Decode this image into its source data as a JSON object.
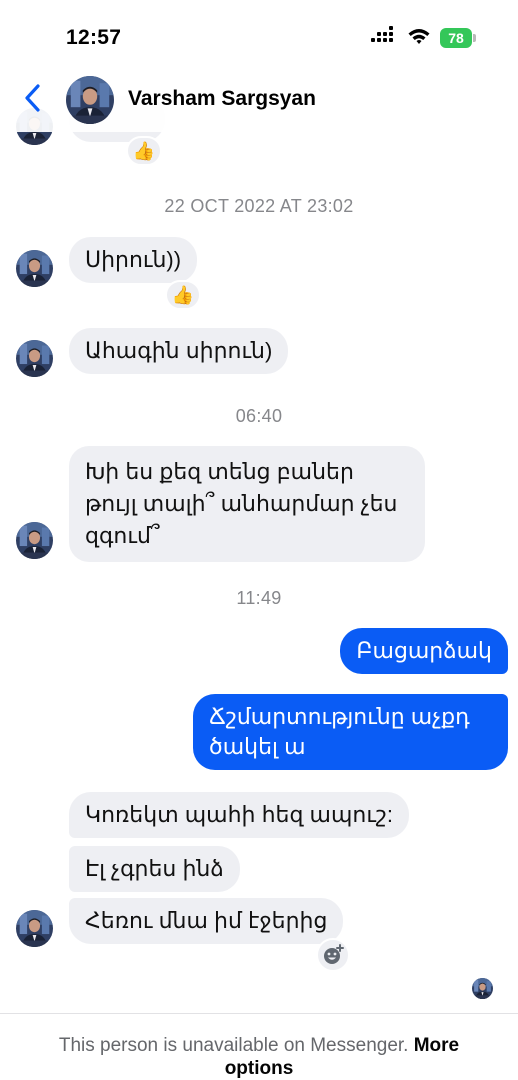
{
  "status_bar": {
    "time": "12:57",
    "battery": "78"
  },
  "header": {
    "name": "Varsham Sargsyan"
  },
  "conversation": {
    "timestamps": [
      "22 OCT 2022 AT 23:02",
      "06:40",
      "11:49"
    ],
    "messages": [
      {
        "text": "Սիրուն))",
        "direction": "incoming"
      },
      {
        "text": "Ահագին սիրուն)",
        "direction": "incoming"
      },
      {
        "text": "Խի ես քեզ տենց բաներ թույլ տալի՞ անհարմար չես զգում՞",
        "direction": "incoming"
      },
      {
        "text": "Բացարձակ",
        "direction": "outgoing"
      },
      {
        "text": "Ճշմարտությունը աչքդ ծակել ա",
        "direction": "outgoing"
      },
      {
        "text": "Կոռեկտ պահի հեզ ապուշ:",
        "direction": "incoming"
      },
      {
        "text": "Էլ չգրես ինձ",
        "direction": "incoming"
      },
      {
        "text": "Հեռու մնա իմ էջերից",
        "direction": "incoming"
      }
    ],
    "reactions": [
      "👍",
      "👍",
      "👍"
    ]
  },
  "footer": {
    "text": "This person is unavailable on Messenger.",
    "link": "More options"
  },
  "colors": {
    "outgoing_bubble": "#0a5cf5",
    "incoming_bubble": "#eeeff3",
    "accent": "#0a5cf5",
    "battery": "#34c759"
  }
}
